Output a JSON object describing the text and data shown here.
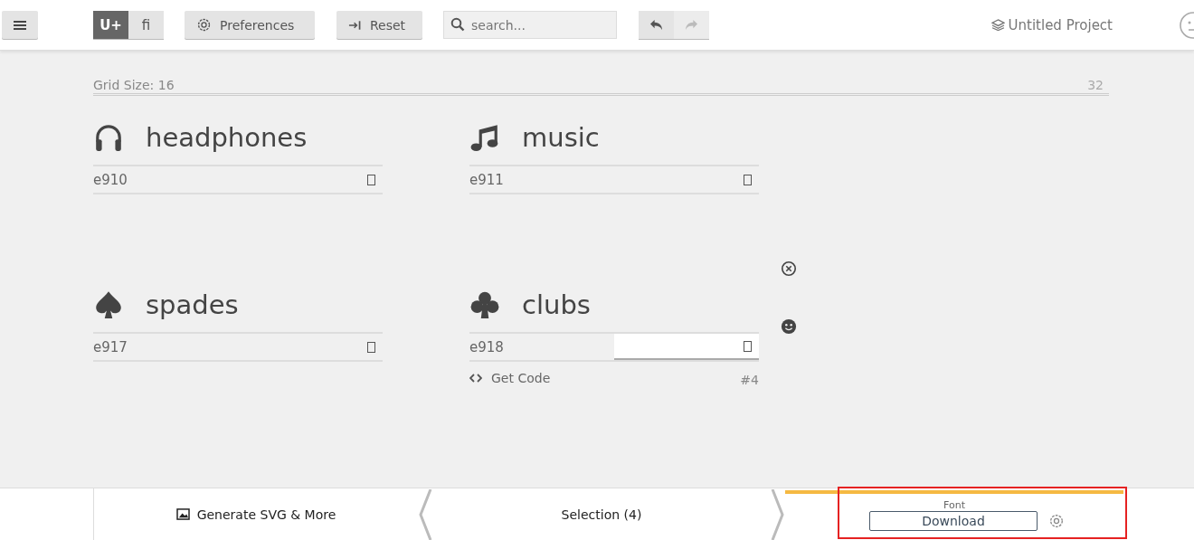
{
  "toolbar": {
    "modes": [
      {
        "label": "U+",
        "selected": true
      },
      {
        "label": "ﬁ",
        "selected": false
      }
    ],
    "preferences": "Preferences",
    "reset": "Reset",
    "search": {
      "placeholder": "search..."
    },
    "undo": {
      "disabled": false
    },
    "redo": {
      "disabled": true
    },
    "project": "Untitled Project"
  },
  "grid": {
    "label": "Grid Size: 16",
    "max": "32"
  },
  "glyphs": [
    {
      "kind": "headphones",
      "name": "headphones",
      "code": "e910",
      "focused": false
    },
    {
      "kind": "music",
      "name": "music",
      "code": "e911",
      "focused": false
    },
    {
      "kind": "spades",
      "name": "spades",
      "code": "e917",
      "focused": false
    },
    {
      "kind": "clubs",
      "name": "clubs",
      "code": "e918",
      "focused": true
    }
  ],
  "selected_glyph": {
    "get_code": "Get Code",
    "index": "#4"
  },
  "footer": {
    "generate": "Generate SVG & More",
    "selection": "Selection (4)",
    "font_label": "Font",
    "download": "Download"
  }
}
